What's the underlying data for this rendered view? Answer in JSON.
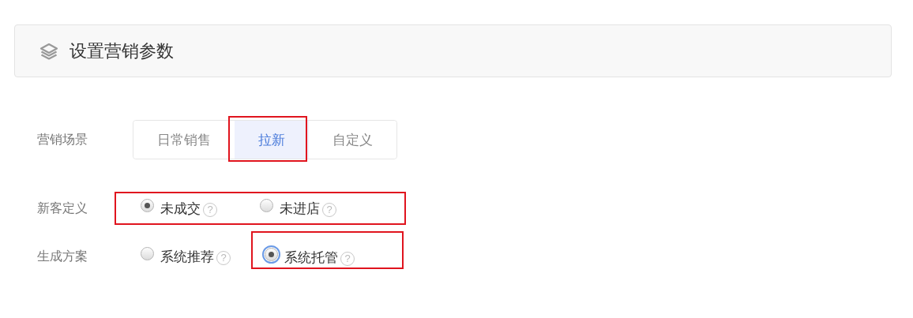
{
  "header": {
    "title": "设置营销参数"
  },
  "rows": [
    {
      "label": "营销场景",
      "kind": "tabs",
      "tabs": [
        {
          "label": "日常销售",
          "selected": false
        },
        {
          "label": "拉新",
          "selected": true,
          "highlighted": true
        },
        {
          "label": "自定义",
          "selected": false
        }
      ]
    },
    {
      "label": "新客定义",
      "kind": "radios",
      "highlighted": true,
      "options": [
        {
          "label": "未成交",
          "help": "?",
          "selected": true
        },
        {
          "label": "未进店",
          "help": "?",
          "selected": false
        }
      ]
    },
    {
      "label": "生成方案",
      "kind": "radios",
      "options": [
        {
          "label": "系统推荐",
          "help": "?",
          "selected": false
        },
        {
          "label": "系统托管",
          "help": "?",
          "selected": true,
          "focused": true,
          "highlighted": true
        }
      ]
    }
  ]
}
